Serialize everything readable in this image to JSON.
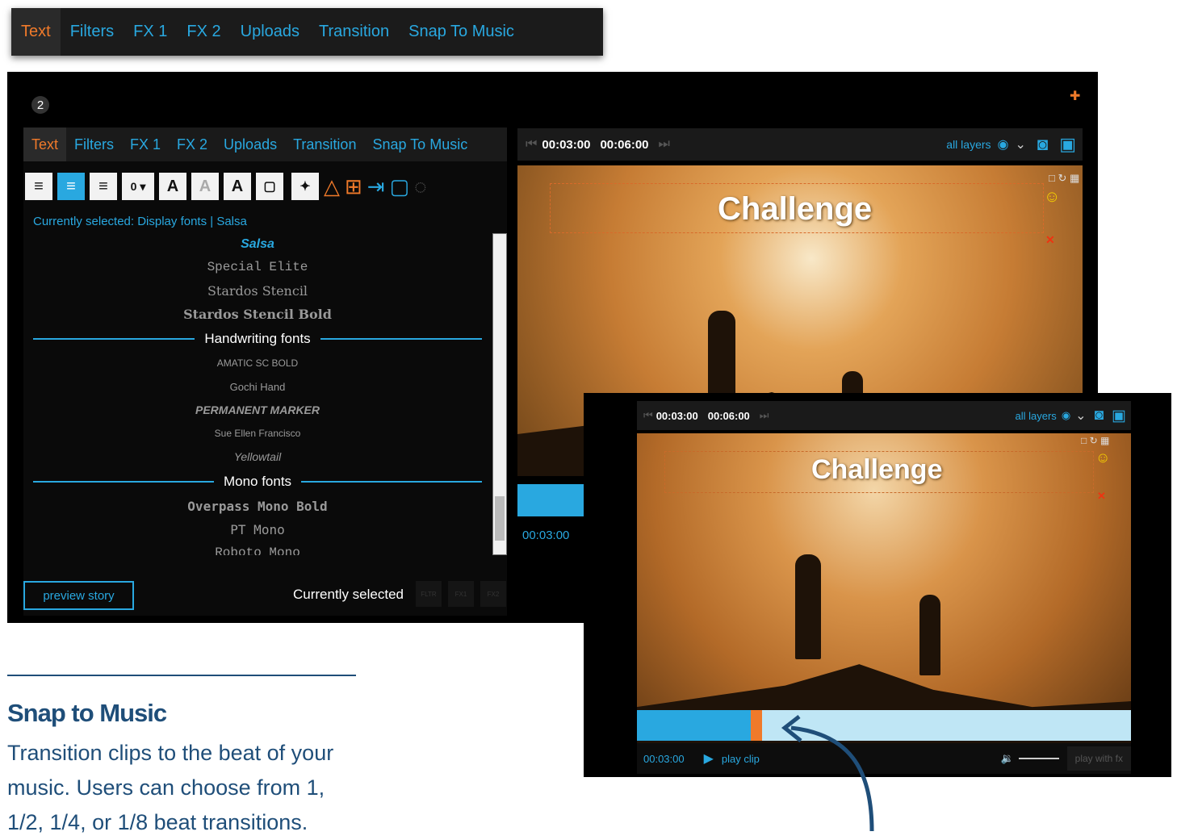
{
  "tabs": [
    "Text",
    "Filters",
    "FX 1",
    "FX 2",
    "Uploads",
    "Transition",
    "Snap To Music"
  ],
  "editor": {
    "badge": "2",
    "currently_selected": "Currently selected: Display fonts | Salsa",
    "fonts_display": [
      "Salsa",
      "Special Elite",
      "Stardos Stencil",
      "Stardos Stencil Bold"
    ],
    "handwriting_header": "Handwriting fonts",
    "fonts_handwriting": [
      "AMATIC SC BOLD",
      "Gochi Hand",
      "PERMANENT MARKER",
      "Sue Ellen Francisco",
      "Yellowtail"
    ],
    "mono_header": "Mono fonts",
    "fonts_mono": [
      "Overpass Mono Bold",
      "PT Mono",
      "Roboto Mono"
    ],
    "preview_btn": "preview story",
    "currently_selected_label": "Currently selected",
    "mini_buttons": [
      "FLTR",
      "FX1",
      "FX2"
    ]
  },
  "player": {
    "time_start": "00:03:00",
    "time_end": "00:06:00",
    "layers": "all layers",
    "clip_title": "Challenge",
    "current_time": "00:03:00",
    "play_clip": "play clip",
    "play_with_fx": "play with fx"
  },
  "colors": {
    "accent": "#29a8e0",
    "active": "#f07a2a",
    "text_dark": "#1f4e79"
  },
  "caption": {
    "title": "Snap to Music",
    "desc": "Transition clips to the beat of your music. Users can choose from 1, 1/2, 1/4, or 1/8 beat transitions."
  }
}
